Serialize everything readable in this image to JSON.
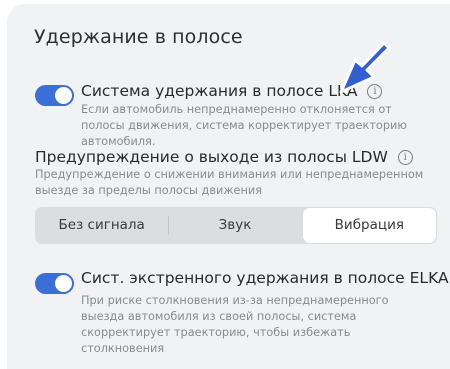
{
  "page": {
    "title": "Удержание в полосе"
  },
  "lka": {
    "enabled": true,
    "title": "Система удержания в полосе LKA",
    "info_icon": "info-icon",
    "description": "Если автомобиль непреднамеренно отклоняется от полосы движения, система корректирует траекторию автомобиля."
  },
  "ldw": {
    "title": "Предупреждение о выходе из полосы LDW",
    "info_icon": "info-icon",
    "description": "Предупреждение о снижении внимания или непреднамеренном выезде за пределы полосы движения",
    "options": [
      "Без сигнала",
      "Звук",
      "Вибрация"
    ],
    "selected": "Вибрация"
  },
  "elka": {
    "enabled": true,
    "title": "Сист. экстренного удержания в полосе ELKA",
    "info_icon": "info-icon",
    "description": "При риске столкновения из-за непреднамеренного выезда автомобиля из своей полосы, система скорректирует траекторию, чтобы избежать столкновения"
  },
  "colors": {
    "accent": "#3b6fd8",
    "panel": "#f1f2f4",
    "arrow": "#2f5fd1"
  }
}
